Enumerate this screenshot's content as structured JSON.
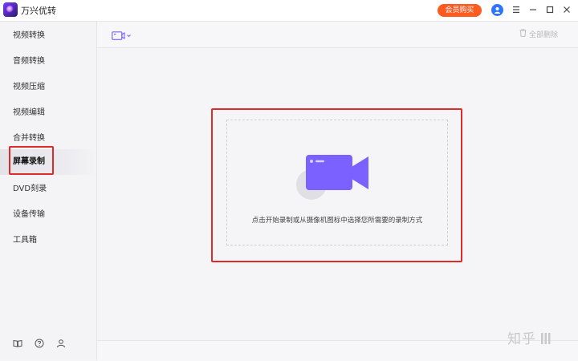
{
  "app": {
    "title": "万兴优转"
  },
  "header": {
    "vip_button": "会员购买",
    "icons": [
      "user-icon",
      "menu-icon",
      "minimize-icon",
      "maximize-icon",
      "close-icon"
    ]
  },
  "sidebar": {
    "items": [
      {
        "label": "视频转换"
      },
      {
        "label": "音频转换"
      },
      {
        "label": "视频压缩"
      },
      {
        "label": "视频编辑"
      },
      {
        "label": "合并转换"
      },
      {
        "label": "屏幕录制",
        "active": true
      },
      {
        "label": "DVD刻录"
      },
      {
        "label": "设备传输"
      },
      {
        "label": "工具箱"
      }
    ],
    "bottom_icons": [
      "book-icon",
      "help-icon",
      "account-icon"
    ]
  },
  "toolbar": {
    "record_source_icon": "camera-record-icon",
    "clear_all": "全部删除"
  },
  "main": {
    "hint": "点击开始录制或从摄像机图标中选择您所需要的录制方式"
  },
  "watermark": "知乎",
  "colors": {
    "accent": "#ff5a1f",
    "highlight_box": "#e02a2a",
    "camera_purple": "#7b61ff",
    "avatar_blue": "#2f74ff"
  }
}
